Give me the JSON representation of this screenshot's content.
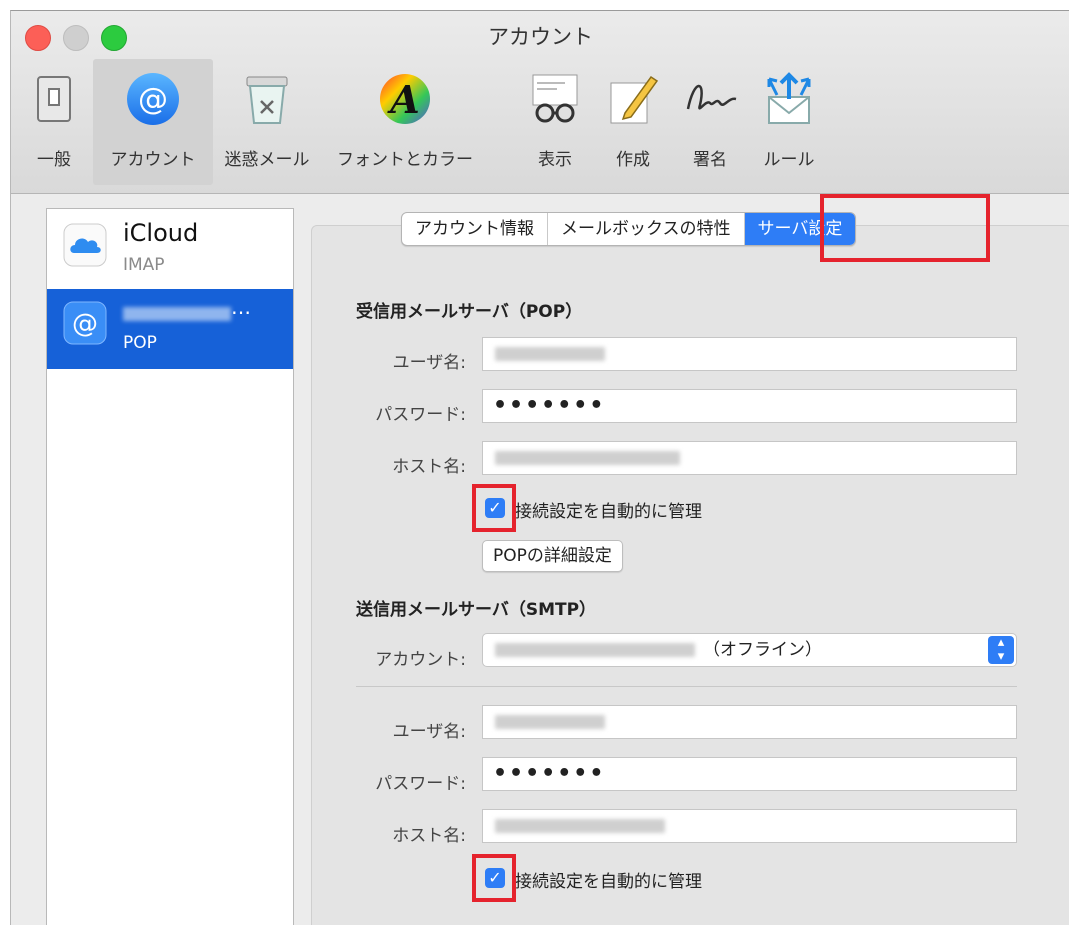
{
  "window": {
    "title": "アカウント"
  },
  "toolbar": {
    "items": [
      {
        "label": "一般",
        "icon": "general-switch-icon"
      },
      {
        "label": "アカウント",
        "icon": "at-sign-icon",
        "selected": true
      },
      {
        "label": "迷惑メール",
        "icon": "junk-trash-icon"
      },
      {
        "label": "フォントとカラー",
        "icon": "fonts-colors-icon"
      },
      {
        "label": "表示",
        "icon": "glasses-icon"
      },
      {
        "label": "作成",
        "icon": "compose-pencil-icon"
      },
      {
        "label": "署名",
        "icon": "signature-icon"
      },
      {
        "label": "ルール",
        "icon": "rules-envelope-icon"
      }
    ]
  },
  "accounts": [
    {
      "name": "iCloud",
      "type": "IMAP",
      "icon": "cloud-icon"
    },
    {
      "name": "…",
      "type": "POP",
      "icon": "at-sign-icon",
      "selected": true
    }
  ],
  "tabs": [
    {
      "label": "アカウント情報"
    },
    {
      "label": "メールボックスの特性"
    },
    {
      "label": "サーバ設定",
      "active": true
    }
  ],
  "incoming": {
    "title": "受信用メールサーバ（POP）",
    "username_label": "ユーザ名:",
    "password_label": "パスワード:",
    "password_value": "•••••••",
    "host_label": "ホスト名:",
    "auto_manage_label": "接続設定を自動的に管理",
    "advanced_button": "POPの詳細設定"
  },
  "outgoing": {
    "title": "送信用メールサーバ（SMTP）",
    "account_label": "アカウント:",
    "account_value_suffix": "（オフライン）",
    "username_label": "ユーザ名:",
    "password_label": "パスワード:",
    "password_value": "•••••••",
    "host_label": "ホスト名:",
    "auto_manage_label": "接続設定を自動的に管理"
  },
  "colors": {
    "accent": "#2e7df6",
    "selection": "#1661d8",
    "highlight_box": "#e5232d"
  }
}
